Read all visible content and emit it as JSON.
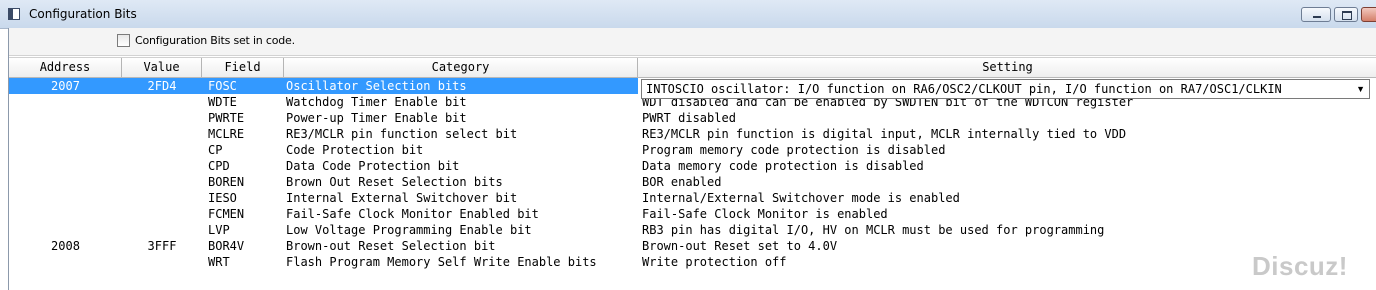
{
  "window": {
    "title": "Configuration Bits"
  },
  "toolstrip": {
    "checkbox_label": "Configuration Bits set in code.",
    "checked": false
  },
  "columns": [
    "Address",
    "Value",
    "Field",
    "Category",
    "Setting"
  ],
  "rows": [
    {
      "address": "2007",
      "value": "2FD4",
      "field": "FOSC",
      "category": "Oscillator Selection bits",
      "setting": "INTOSCIO oscillator: I/O function on RA6/OSC2/CLKOUT pin, I/O function on RA7/OSC1/CLKIN",
      "selected": true
    },
    {
      "address": "",
      "value": "",
      "field": "WDTE",
      "category": "Watchdog Timer Enable bit",
      "setting": "WDT disabled and can be enabled by SWDTEN bit of the WDTCON register"
    },
    {
      "address": "",
      "value": "",
      "field": "PWRTE",
      "category": "Power-up Timer Enable bit",
      "setting": "PWRT disabled"
    },
    {
      "address": "",
      "value": "",
      "field": "MCLRE",
      "category": "RE3/MCLR pin function select bit",
      "setting": "RE3/MCLR pin function is digital input, MCLR internally tied to VDD"
    },
    {
      "address": "",
      "value": "",
      "field": "CP",
      "category": "Code Protection bit",
      "setting": "Program memory code protection is disabled"
    },
    {
      "address": "",
      "value": "",
      "field": "CPD",
      "category": "Data Code Protection bit",
      "setting": "Data memory code protection is disabled"
    },
    {
      "address": "",
      "value": "",
      "field": "BOREN",
      "category": "Brown Out Reset Selection bits",
      "setting": "BOR enabled"
    },
    {
      "address": "",
      "value": "",
      "field": "IESO",
      "category": "Internal External Switchover bit",
      "setting": "Internal/External Switchover mode is enabled"
    },
    {
      "address": "",
      "value": "",
      "field": "FCMEN",
      "category": "Fail-Safe Clock Monitor Enabled bit",
      "setting": "Fail-Safe Clock Monitor is enabled"
    },
    {
      "address": "",
      "value": "",
      "field": "LVP",
      "category": "Low Voltage Programming Enable bit",
      "setting": "RB3 pin has digital I/O, HV on MCLR must be used for programming"
    },
    {
      "address": "2008",
      "value": "3FFF",
      "field": "BOR4V",
      "category": "Brown-out Reset Selection bit",
      "setting": "Brown-out Reset set to 4.0V"
    },
    {
      "address": "",
      "value": "",
      "field": "WRT",
      "category": "Flash Program Memory Self Write Enable bits",
      "setting": "Write protection off"
    }
  ],
  "dropdown": {
    "value": "INTOSCIO oscillator: I/O function on RA6/OSC2/CLKOUT pin, I/O function on RA7/OSC1/CLKIN",
    "arrow_icon": "triangle-down"
  },
  "watermark": {
    "text": "Discuz!"
  },
  "colors": {
    "selection": "#3399ff",
    "titlebar": "#c9d9ec"
  }
}
